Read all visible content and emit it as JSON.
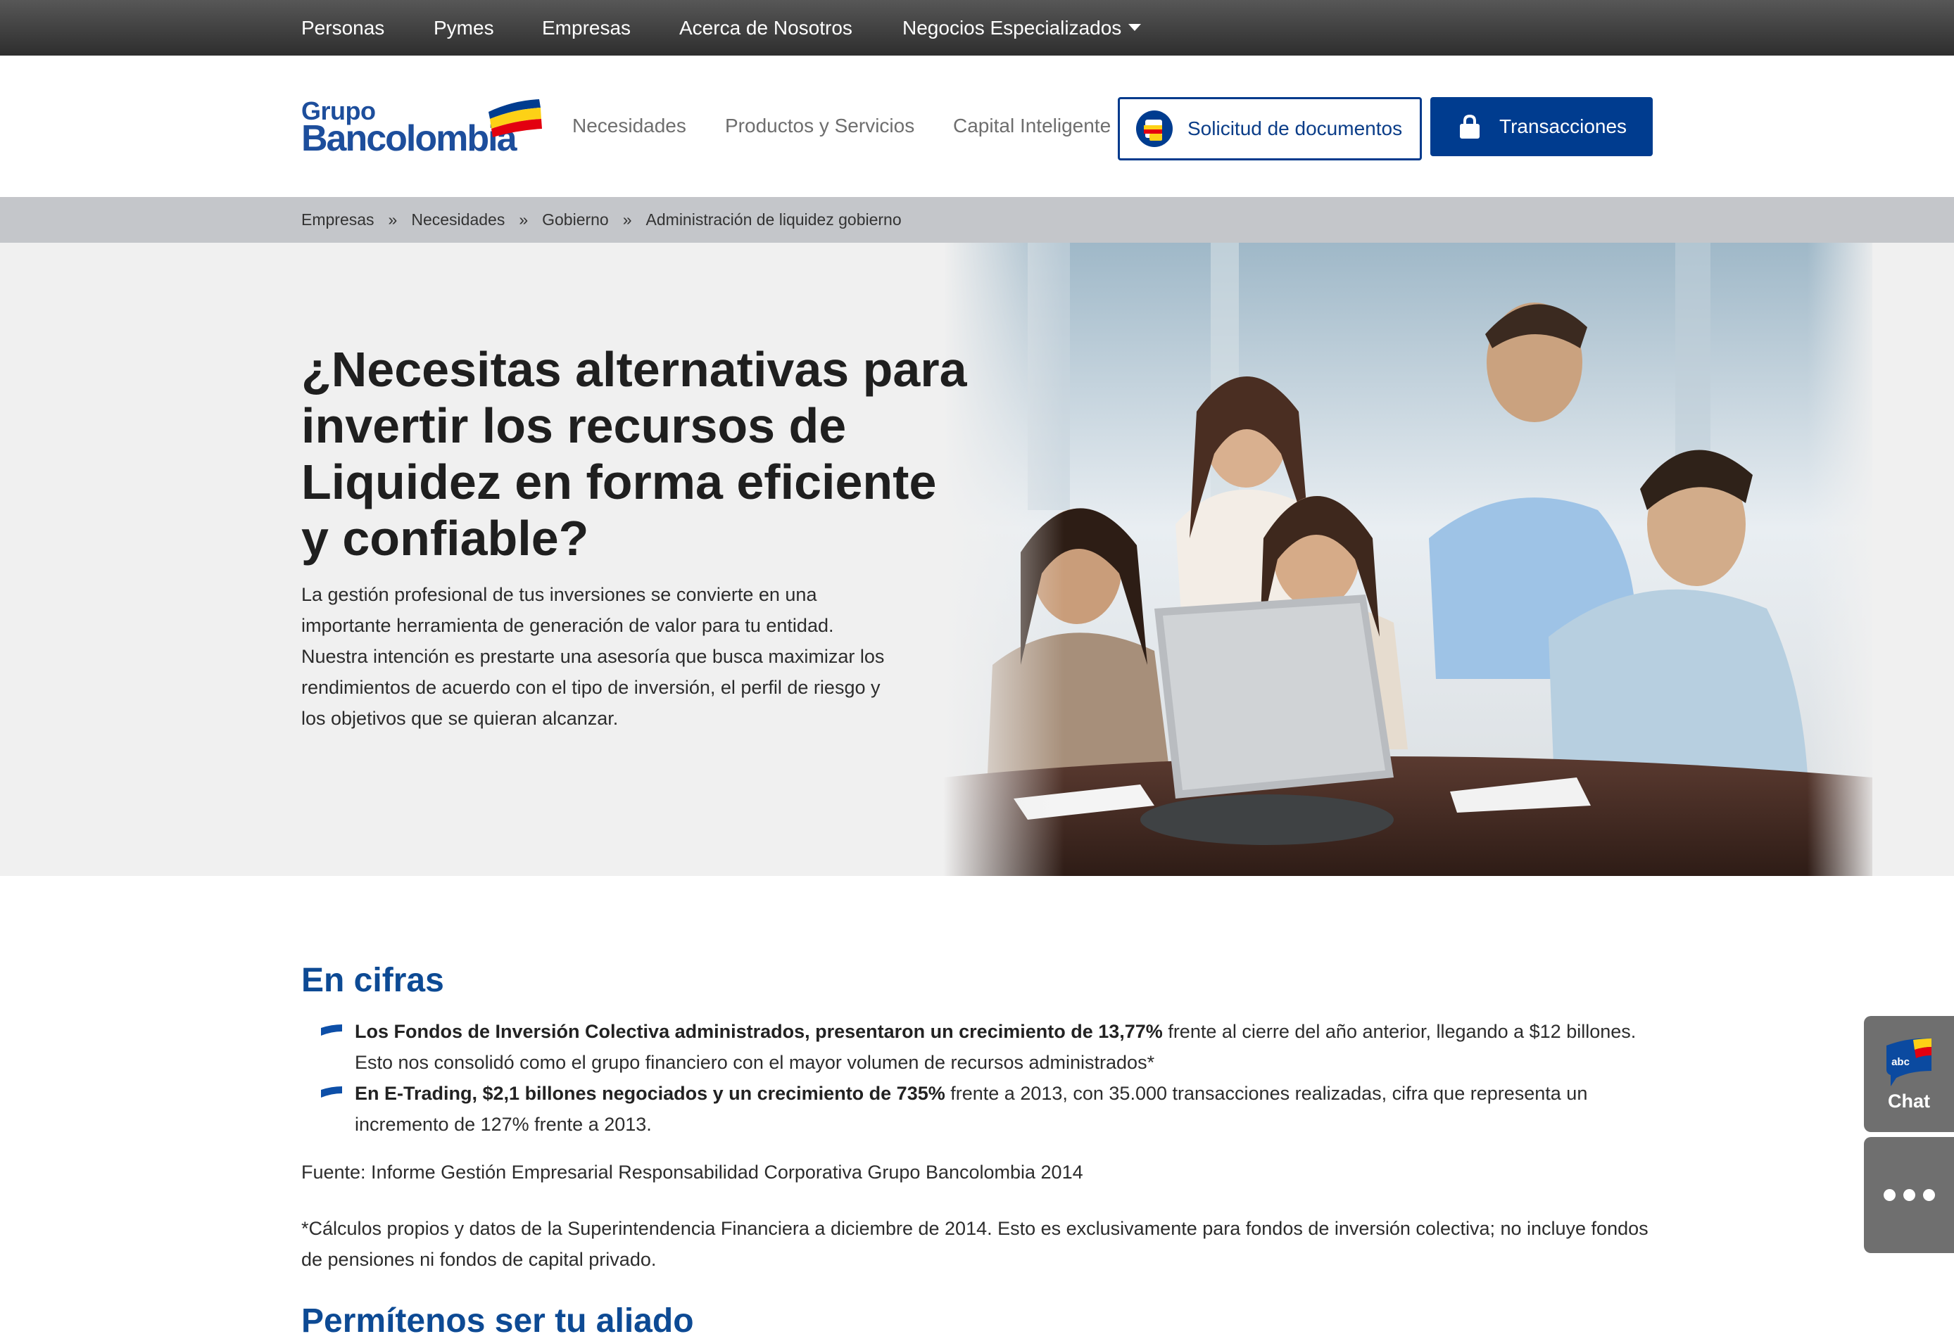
{
  "topnav": {
    "items": [
      "Personas",
      "Pymes",
      "Empresas",
      "Acerca de Nosotros",
      "Negocios Especializados"
    ]
  },
  "header": {
    "logo": {
      "line1": "Grupo",
      "line2": "Bancolombia"
    },
    "links": [
      "Necesidades",
      "Productos y Servicios",
      "Capital Inteligente"
    ],
    "docs_button": "Solicitud de documentos",
    "transactions_button": "Transacciones"
  },
  "breadcrumb": {
    "items": [
      "Empresas",
      "Necesidades",
      "Gobierno",
      "Administración de liquidez gobierno"
    ],
    "separator": "»"
  },
  "hero": {
    "title": "¿Necesitas alternativas para invertir los recursos de Liquidez en forma eficiente y confiable?",
    "text": "La gestión profesional de tus inversiones se convierte en una importante herramienta de generación de valor para tu entidad. Nuestra intención es prestarte una asesoría que busca maximizar los rendimientos de acuerdo con el tipo de inversión, el perfil de riesgo y los objetivos que se quieran alcanzar."
  },
  "cifras": {
    "heading": "En cifras",
    "bullets": [
      {
        "bold": "Los Fondos de Inversión Colectiva administrados, presentaron un crecimiento de 13,77%",
        "rest": " frente al cierre del año anterior, llegando a $12 billones. Esto nos consolidó como el grupo financiero con el mayor volumen de recursos administrados*"
      },
      {
        "bold": "En E-Trading, $2,1 billones negociados y un crecimiento de 735%",
        "rest": " frente a 2013, con 35.000 transacciones realizadas, cifra que representa un incremento de 127% frente a 2013."
      }
    ],
    "source": "Fuente: Informe Gestión Empresarial Responsabilidad Corporativa Grupo Bancolombia 2014",
    "note": "*Cálculos propios y datos de la Superintendencia Financiera a diciembre de 2014. Esto es exclusivamente para fondos de inversión colectiva; no incluye fondos de pensiones ni fondos de capital privado."
  },
  "aliado": {
    "heading": "Permítenos ser tu aliado"
  },
  "side": {
    "chat_label": "Chat",
    "chat_icon_text": "abc"
  },
  "colors": {
    "brand_blue": "#003c8f",
    "topnav": "#3a3a3a",
    "breadcrumb_bg": "#c4c6ca",
    "hero_bg": "#f0f0f0",
    "flag_yellow": "#fdd116",
    "flag_red": "#e3000f"
  },
  "icons": [
    "caret-down-icon",
    "documents-icon",
    "lock-icon",
    "bullet-flag-icon",
    "chat-icon",
    "more-icon"
  ]
}
